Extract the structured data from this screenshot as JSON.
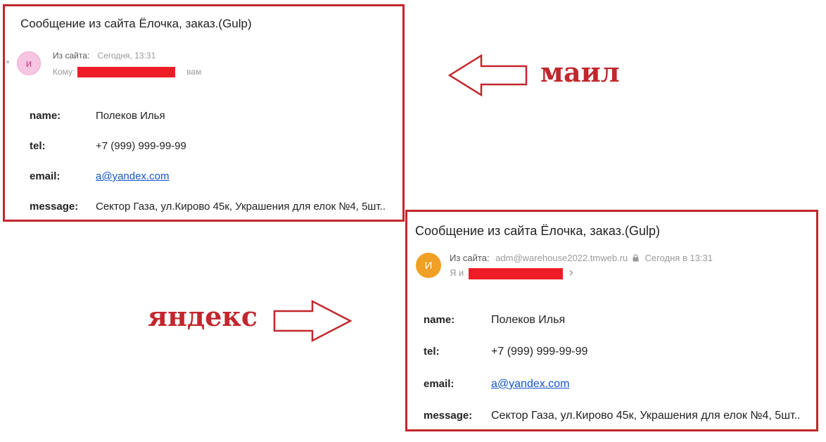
{
  "mail": {
    "subject": "Сообщение из сайта Ёлочка, заказ.(Gulp)",
    "avatar_letter": "и",
    "from_label": "Из сайта:",
    "time": "Сегодня, 13:31",
    "to_label": "Кому:",
    "to_suffix": "вам",
    "fields": [
      {
        "key": "name:",
        "value": "Полеков Илья"
      },
      {
        "key": "tel:",
        "value": "+7 (999) 999-99-99"
      },
      {
        "key": "email:",
        "value": "a@yandex.com"
      },
      {
        "key": "message:",
        "value": "Сектор Газа, ул.Кирово 45к, Украшения для елок №4, 5шт.."
      }
    ]
  },
  "yandex": {
    "subject": "Сообщение из сайта Ёлочка, заказ.(Gulp)",
    "avatar_letter": "И",
    "from_label": "Из сайта:",
    "from_email": "adm@warehouse2022.tmweb.ru",
    "time": "Сегодня в 13:31",
    "to_label": "Я и",
    "fields": [
      {
        "key": "name:",
        "value": "Полеков Илья"
      },
      {
        "key": "tel:",
        "value": "+7 (999) 999-99-99"
      },
      {
        "key": "email:",
        "value": "a@yandex.com"
      },
      {
        "key": "message:",
        "value": "Сектор Газа, ул.Кирово 45к, Украшения для елок №4, 5шт.."
      }
    ]
  },
  "annotations": {
    "mail_label": "маил",
    "yandex_label": "яндекс"
  },
  "colors": {
    "frame": "#c1272d",
    "redaction": "#ee1c25",
    "link": "#1155cc",
    "mail_avatar_bg": "#f7c4e2",
    "yandex_avatar_bg": "#f0a025"
  },
  "icons": {
    "lock": "lock-icon",
    "chevron": "chevron-right-icon"
  }
}
